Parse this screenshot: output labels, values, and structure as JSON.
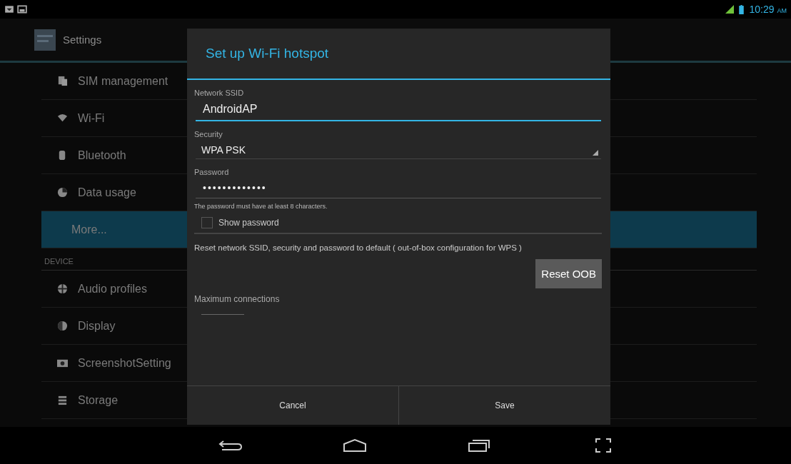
{
  "status_bar": {
    "time": "10:29",
    "ampm": "AM"
  },
  "action_bar": {
    "title": "Settings"
  },
  "settings_list": [
    {
      "kind": "item",
      "label": "SIM management",
      "selected": false
    },
    {
      "kind": "item",
      "label": "Wi-Fi",
      "selected": false
    },
    {
      "kind": "item",
      "label": "Bluetooth",
      "selected": false
    },
    {
      "kind": "item",
      "label": "Data usage",
      "selected": false
    },
    {
      "kind": "item",
      "label": "More...",
      "selected": true
    },
    {
      "kind": "header",
      "label": "DEVICE"
    },
    {
      "kind": "item",
      "label": "Audio profiles",
      "selected": false
    },
    {
      "kind": "item",
      "label": "Display",
      "selected": false
    },
    {
      "kind": "item",
      "label": "ScreenshotSetting",
      "selected": false
    },
    {
      "kind": "item",
      "label": "Storage",
      "selected": false
    }
  ],
  "dialog": {
    "title": "Set up Wi-Fi hotspot",
    "ssid": {
      "label": "Network SSID",
      "value": "AndroidAP"
    },
    "security": {
      "label": "Security",
      "value": "WPA PSK"
    },
    "password": {
      "label": "Password",
      "value": "•••••••••••••",
      "hint": "The password must have at least 8 characters."
    },
    "show_password": {
      "label": "Show password",
      "checked": false
    },
    "reset_text": "Reset network SSID, security and password to default ( out-of-box configuration for WPS )",
    "reset_button": "Reset OOB",
    "max_connections": {
      "label": "Maximum connections"
    },
    "buttons": [
      "Cancel",
      "Save"
    ]
  }
}
